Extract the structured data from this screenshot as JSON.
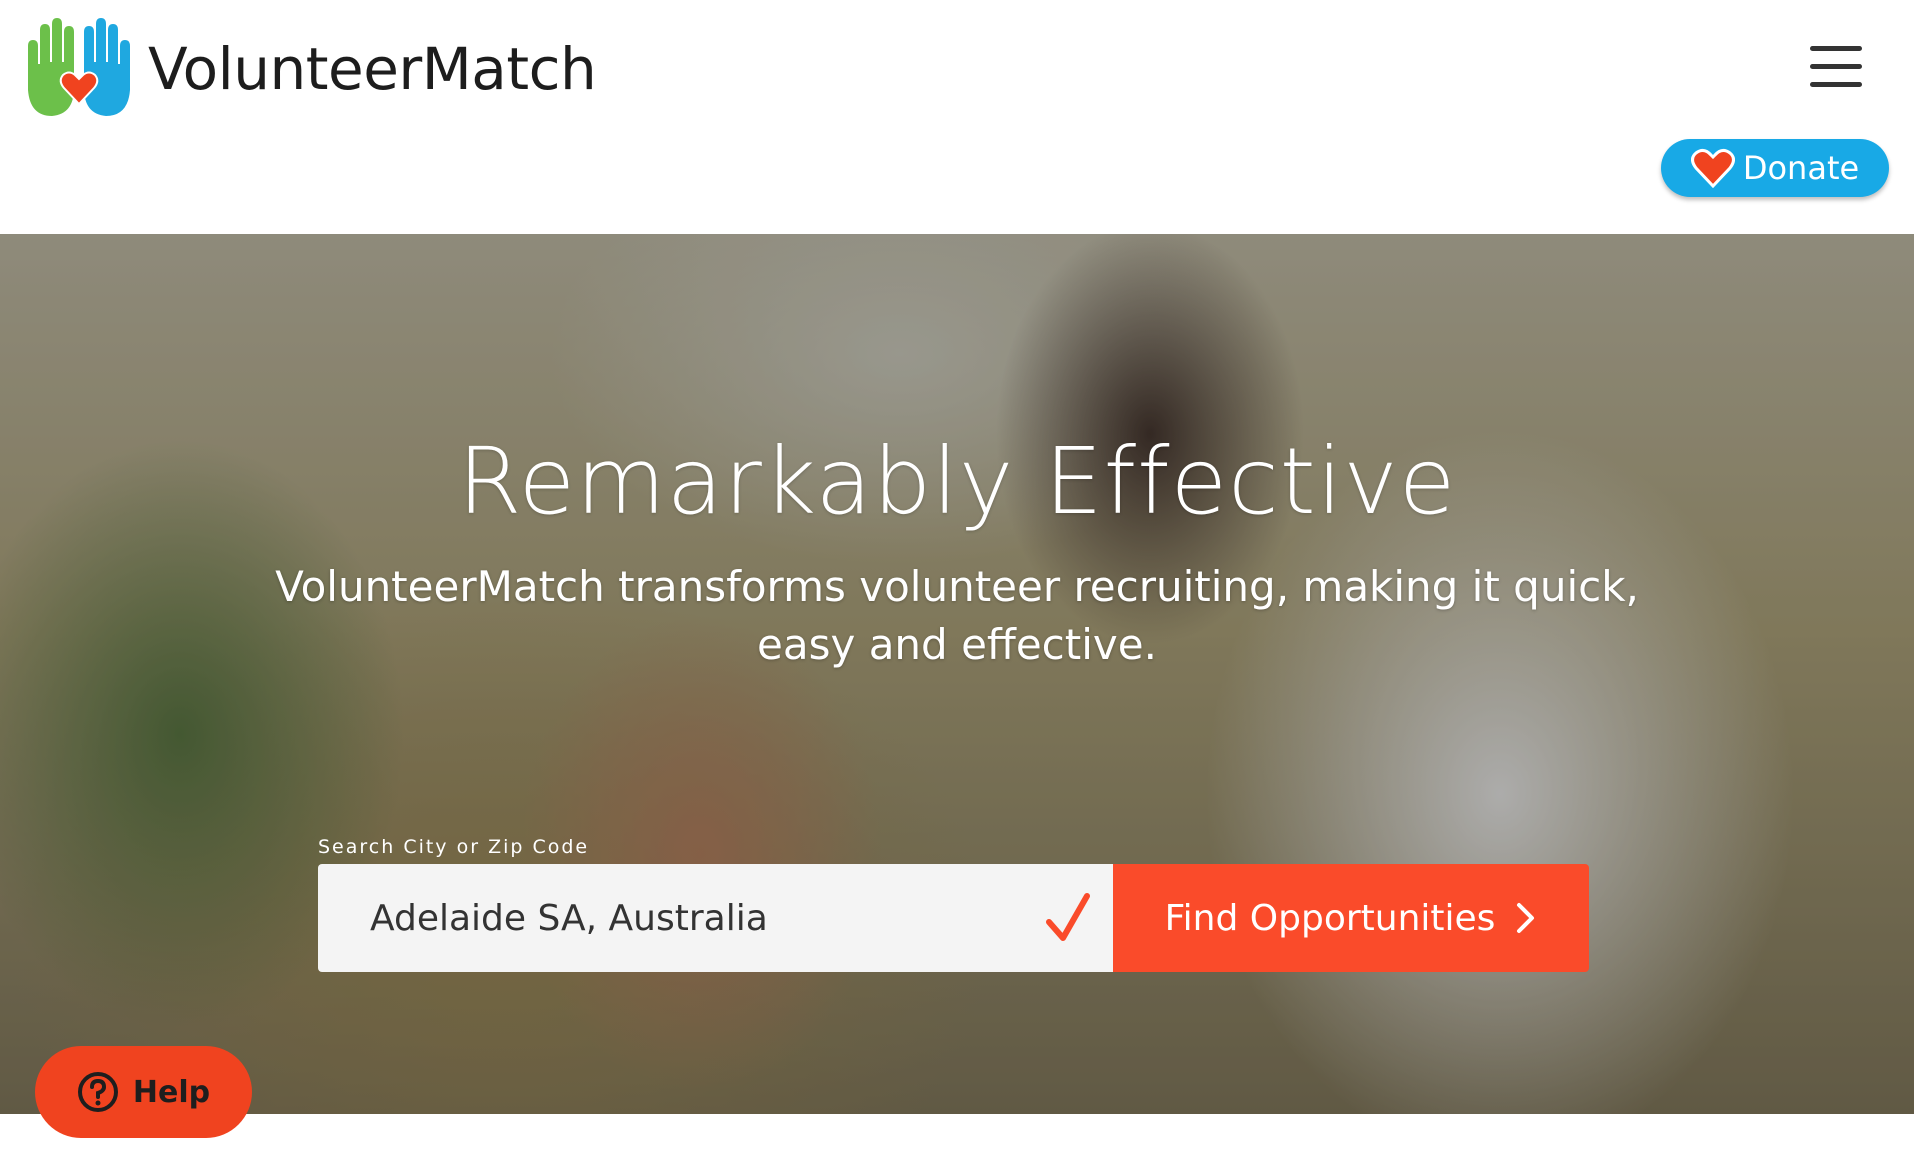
{
  "header": {
    "brand": "VolunteerMatch",
    "menu_icon": "hamburger-menu-icon",
    "donate_label": "Donate",
    "donate_icon": "heart-icon"
  },
  "hero": {
    "title": "Remarkably Effective",
    "subtitle": "VolunteerMatch transforms volunteer recruiting, making it quick, easy and effective.",
    "search_label": "Search City or Zip Code",
    "search_value": "Adelaide SA, Australia",
    "search_status_icon": "checkmark-icon",
    "find_button_label": "Find Opportunities",
    "find_button_icon": "chevron-right-icon"
  },
  "help": {
    "label": "Help",
    "icon": "question-circle-icon"
  },
  "colors": {
    "donate_blue": "#18a9e6",
    "accent_orange": "#fa4b2a",
    "help_orange": "#f0431f",
    "logo_green": "#6cc04a",
    "logo_blue": "#1fa8e0",
    "heart_red": "#f0431f"
  }
}
